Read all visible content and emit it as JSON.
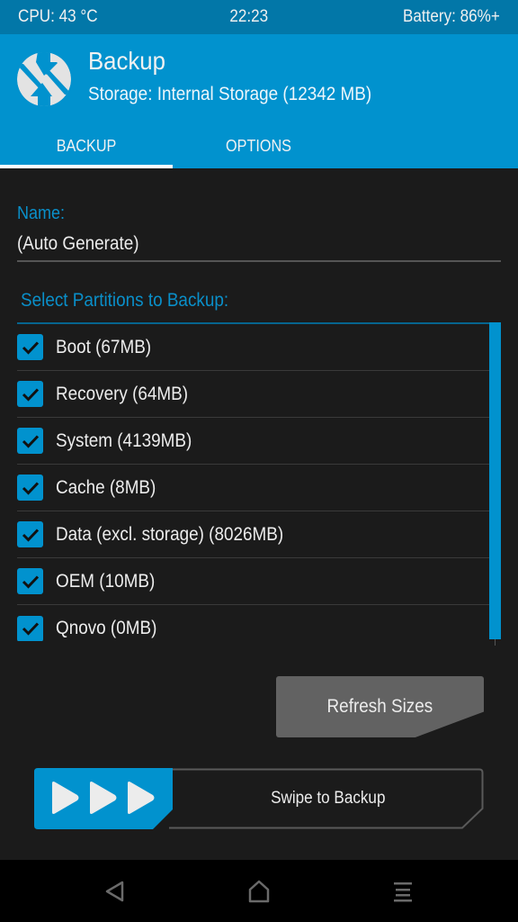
{
  "status_bar": {
    "cpu": "CPU: 43 °C",
    "time": "22:23",
    "battery": "Battery: 86%+"
  },
  "header": {
    "logo_icon": "twrp-logo-icon",
    "title": "Backup",
    "subtitle": "Storage: Internal Storage (12342 MB)"
  },
  "tabs": [
    {
      "label": "BACKUP",
      "active": true
    },
    {
      "label": "OPTIONS",
      "active": false
    }
  ],
  "name_field": {
    "label": "Name:",
    "value": "(Auto Generate)"
  },
  "partitions": {
    "label": "Select Partitions to Backup:",
    "items": [
      {
        "label": "Boot (67MB)",
        "checked": true
      },
      {
        "label": "Recovery (64MB)",
        "checked": true
      },
      {
        "label": "System (4139MB)",
        "checked": true
      },
      {
        "label": "Cache (8MB)",
        "checked": true
      },
      {
        "label": "Data (excl. storage) (8026MB)",
        "checked": true
      },
      {
        "label": "OEM (10MB)",
        "checked": true
      },
      {
        "label": "Qnovo (0MB)",
        "checked": true
      }
    ]
  },
  "buttons": {
    "refresh_sizes": "Refresh Sizes",
    "swipe_label": "Swipe to Backup"
  },
  "navbar": {
    "back_icon": "back-triangle-icon",
    "home_icon": "home-icon",
    "menu_icon": "menu-icon"
  },
  "colors": {
    "accent": "#0192ce",
    "status_bar": "#0277a8",
    "background": "#1b1b1b",
    "button_gray": "#626262"
  }
}
